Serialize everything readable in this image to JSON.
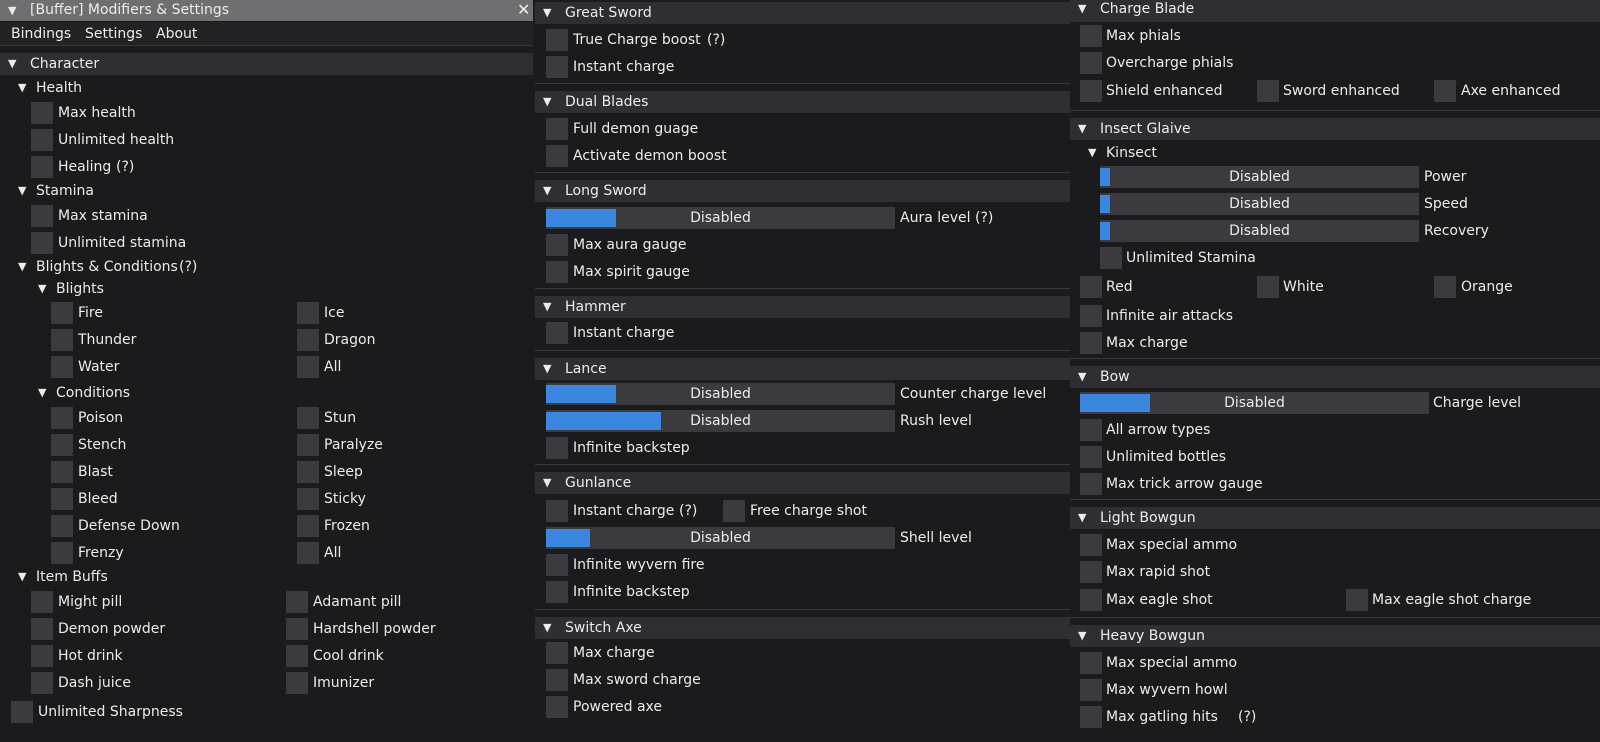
{
  "window": {
    "title": "[Buffer] Modifiers & Settings",
    "close_glyph": "✕"
  },
  "menu": [
    "Bindings",
    "Settings",
    "About"
  ],
  "tri_open": "▼",
  "help": "(?)",
  "character": {
    "title": "Character",
    "health": {
      "title": "Health",
      "items": [
        "Max health",
        "Unlimited health",
        "Healing"
      ]
    },
    "stamina": {
      "title": "Stamina",
      "items": [
        "Max stamina",
        "Unlimited stamina"
      ]
    },
    "blights_conditions": {
      "title": "Blights & Conditions",
      "blights": {
        "title": "Blights",
        "left": [
          "Fire",
          "Thunder",
          "Water"
        ],
        "right": [
          "Ice",
          "Dragon",
          "All"
        ]
      },
      "conditions": {
        "title": "Conditions",
        "left": [
          "Poison",
          "Stench",
          "Blast",
          "Bleed",
          "Defense Down",
          "Frenzy"
        ],
        "right": [
          "Stun",
          "Paralyze",
          "Sleep",
          "Sticky",
          "Frozen",
          "All"
        ]
      }
    },
    "item_buffs": {
      "title": "Item Buffs",
      "left": [
        "Might pill",
        "Demon powder",
        "Hot drink",
        "Dash juice"
      ],
      "right": [
        "Adamant pill",
        "Hardshell powder",
        "Cool drink",
        "Imunizer"
      ]
    },
    "unlimited_sharpness": "Unlimited Sharpness"
  },
  "great_sword": {
    "title": "Great Sword",
    "items": [
      "True Charge boost",
      "Instant charge"
    ]
  },
  "dual_blades": {
    "title": "Dual Blades",
    "items": [
      "Full demon guage",
      "Activate demon boost"
    ]
  },
  "long_sword": {
    "title": "Long Sword",
    "slider": {
      "value": "Disabled",
      "label": "Aura level",
      "fill_fraction": 0.2
    },
    "items": [
      "Max aura gauge",
      "Max spirit gauge"
    ]
  },
  "hammer": {
    "title": "Hammer",
    "items": [
      "Instant charge"
    ]
  },
  "lance": {
    "title": "Lance",
    "sliders": [
      {
        "value": "Disabled",
        "label": "Counter charge level",
        "fill_fraction": 0.2
      },
      {
        "value": "Disabled",
        "label": "Rush level",
        "fill_fraction": 0.33
      }
    ],
    "items": [
      "Infinite backstep"
    ]
  },
  "gunlance": {
    "title": "Gunlance",
    "instant_charge": "Instant charge",
    "free_charge_shot": "Free charge shot",
    "slider": {
      "value": "Disabled",
      "label": "Shell level",
      "fill_fraction": 0.125
    },
    "items": [
      "Infinite wyvern fire",
      "Infinite backstep"
    ]
  },
  "switch_axe": {
    "title": "Switch Axe",
    "items": [
      "Max charge",
      "Max sword charge",
      "Powered axe"
    ]
  },
  "charge_blade": {
    "title": "Charge Blade",
    "items": [
      "Max phials",
      "Overcharge phials"
    ],
    "row": [
      "Shield enhanced",
      "Sword enhanced",
      "Axe enhanced"
    ]
  },
  "insect_glaive": {
    "title": "Insect Glaive",
    "kinsect": {
      "title": "Kinsect",
      "sliders": [
        {
          "value": "Disabled",
          "label": "Power",
          "fill_fraction": 0.03
        },
        {
          "value": "Disabled",
          "label": "Speed",
          "fill_fraction": 0.03
        },
        {
          "value": "Disabled",
          "label": "Recovery",
          "fill_fraction": 0.03
        }
      ],
      "unlimited_stamina": "Unlimited Stamina"
    },
    "extracts": [
      "Red",
      "White",
      "Orange"
    ],
    "items": [
      "Infinite air attacks",
      "Max charge"
    ]
  },
  "bow": {
    "title": "Bow",
    "slider": {
      "value": "Disabled",
      "label": "Charge level",
      "fill_fraction": 0.2
    },
    "items": [
      "All arrow types",
      "Unlimited bottles",
      "Max trick arrow gauge"
    ]
  },
  "light_bowgun": {
    "title": "Light Bowgun",
    "items": [
      "Max special ammo",
      "Max rapid shot"
    ],
    "row": [
      "Max eagle shot",
      "Max eagle shot charge"
    ]
  },
  "heavy_bowgun": {
    "title": "Heavy Bowgun",
    "items": [
      "Max special ammo",
      "Max wyvern howl",
      "Max gatling hits"
    ]
  }
}
